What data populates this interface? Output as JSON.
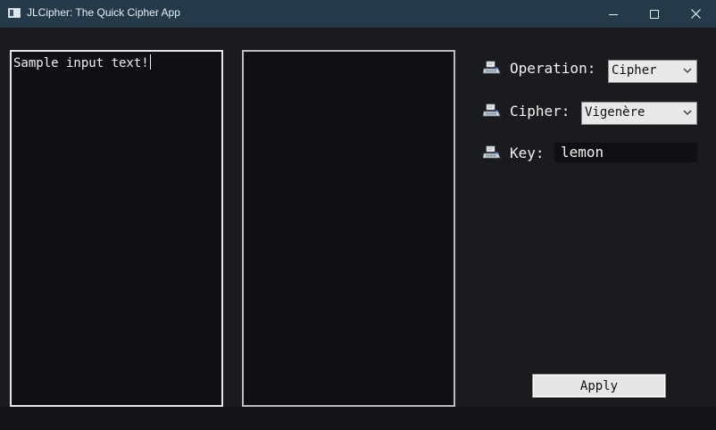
{
  "window": {
    "title": "JLCipher: The Quick Cipher App"
  },
  "icons": {
    "app": "app-window-icon",
    "minimize": "minimize-icon",
    "maximize": "maximize-icon",
    "close": "close-icon",
    "row": "keyboard-printer-icon",
    "dropdown": "chevron-down-icon"
  },
  "input": {
    "text": "Sample input text!"
  },
  "output": {
    "text": ""
  },
  "operation": {
    "label": "Operation:",
    "selected": "Cipher"
  },
  "cipher": {
    "label": "Cipher:",
    "selected": "Vigenère"
  },
  "key": {
    "label": "Key:",
    "value": "lemon"
  },
  "actions": {
    "apply_label": "Apply"
  },
  "colors": {
    "titlebar": "#253a49",
    "background": "#1a1b1f",
    "text_area": "#101014",
    "text": "#f2f2f2"
  }
}
